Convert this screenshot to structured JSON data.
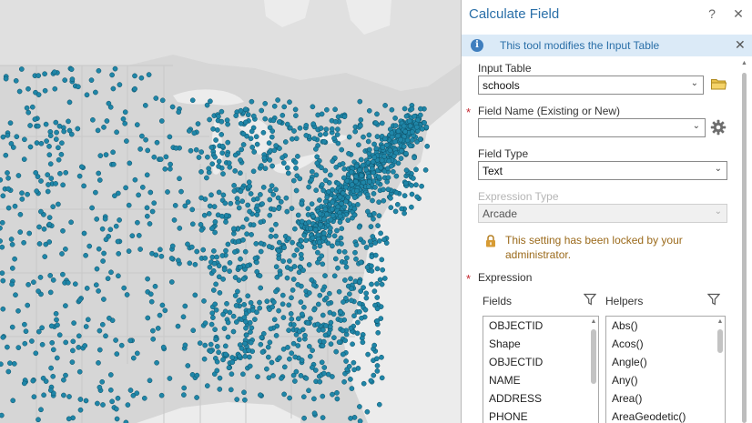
{
  "pane": {
    "title": "Calculate Field",
    "help_glyph": "?",
    "close_glyph": "✕"
  },
  "info_bar": {
    "text": "This tool modifies the Input Table",
    "icon_glyph": "i",
    "close_glyph": "✕"
  },
  "input_table": {
    "label": "Input Table",
    "value": "schools"
  },
  "field_name": {
    "label": "Field Name (Existing or New)",
    "value": "",
    "required_mark": "*"
  },
  "field_type": {
    "label": "Field Type",
    "value": "Text"
  },
  "expression_type": {
    "label": "Expression Type",
    "value": "Arcade",
    "locked_message": "This setting has been locked by your administrator."
  },
  "expression": {
    "label": "Expression",
    "required_mark": "*",
    "fields_label": "Fields",
    "helpers_label": "Helpers",
    "fields": [
      "OBJECTID",
      "Shape",
      "OBJECTID",
      "NAME",
      "ADDRESS",
      "PHONE"
    ],
    "helpers": [
      "Abs()",
      "Acos()",
      "Angle()",
      "Any()",
      "Area()",
      "AreaGeodetic()"
    ]
  },
  "glyphs": {
    "chevron_down": "⌄",
    "scroll_up": "▲",
    "scroll_down": "▼"
  },
  "colors": {
    "accent": "#2a6fa8",
    "required": "#c4262e",
    "warning_text": "#9b6a1b",
    "point_fill": "#1f86a8",
    "land": "#d6d6d6",
    "water": "#ececec"
  },
  "icons": {
    "folder": "folder-icon",
    "gear": "gear-icon",
    "lock": "lock-icon",
    "filter": "filter-icon",
    "info": "info-icon"
  }
}
